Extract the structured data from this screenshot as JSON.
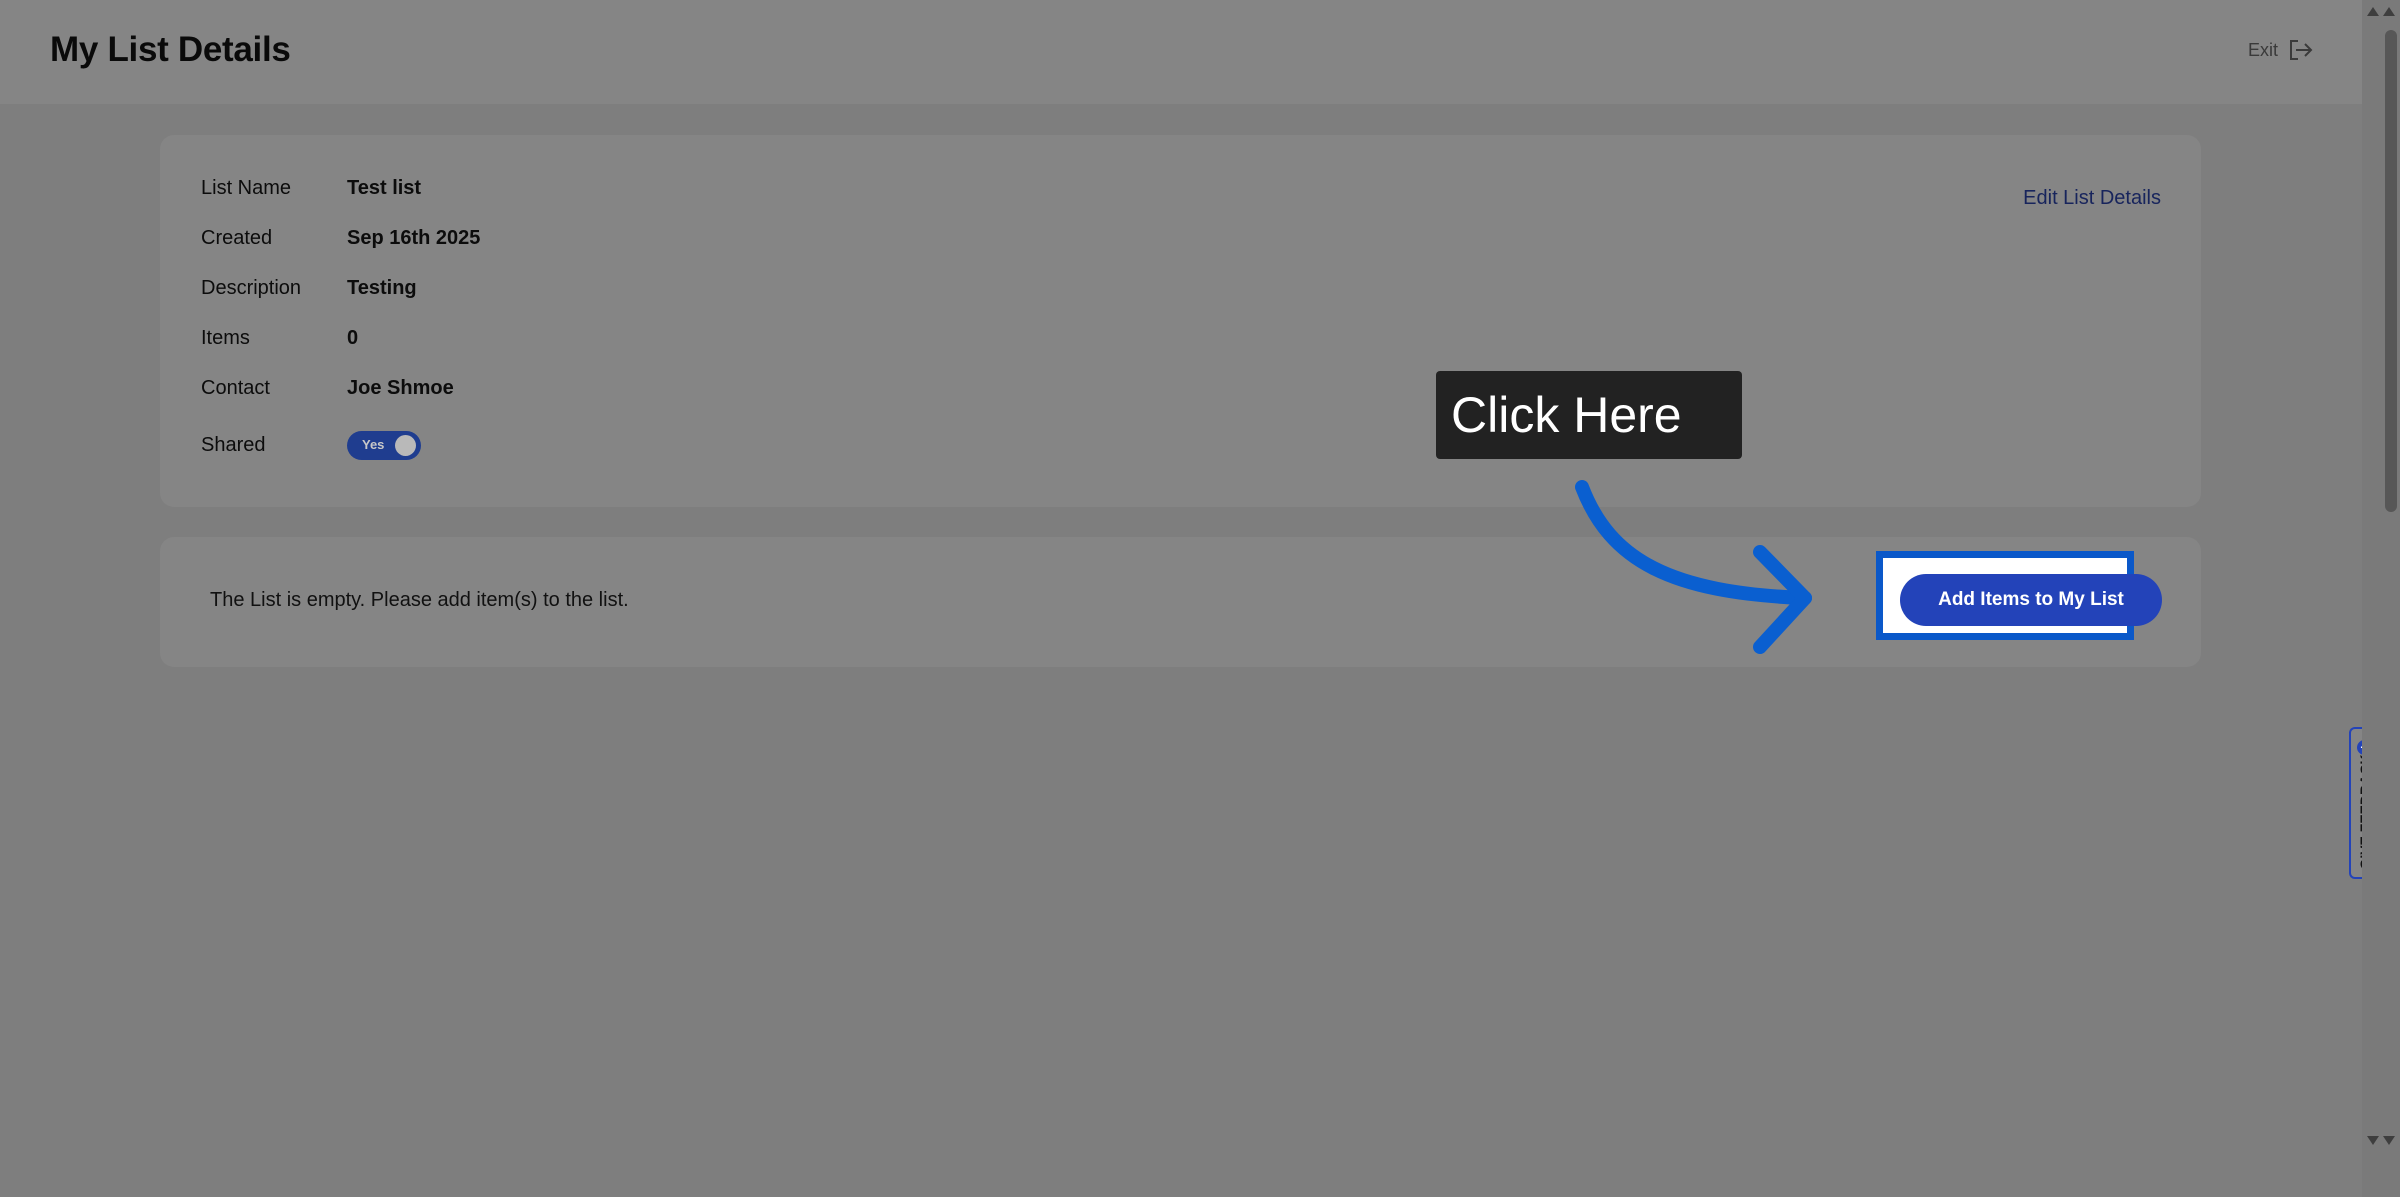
{
  "header": {
    "title": "My List Details",
    "exit_label": "Exit"
  },
  "details": {
    "rows": [
      {
        "label": "List Name",
        "value": "Test list"
      },
      {
        "label": "Created",
        "value": "Sep 16th 2025"
      },
      {
        "label": "Description",
        "value": "Testing"
      },
      {
        "label": "Items",
        "value": "0"
      },
      {
        "label": "Contact",
        "value": "Joe Shmoe"
      }
    ],
    "shared_label": "Shared",
    "shared_toggle_text": "Yes",
    "edit_link": "Edit List Details"
  },
  "list": {
    "empty_message": "The List is empty. Please add item(s) to the list.",
    "add_button": "Add Items to My List"
  },
  "annotation": {
    "tooltip": "Click Here",
    "highlight_color": "#0a58c9",
    "arrow_color": "#0a5fd0"
  },
  "feedback": {
    "label": "GIVE FEEDBACK",
    "plus": "+"
  },
  "colors": {
    "accent": "#2343b9",
    "overlay": "#7e7e7e"
  }
}
